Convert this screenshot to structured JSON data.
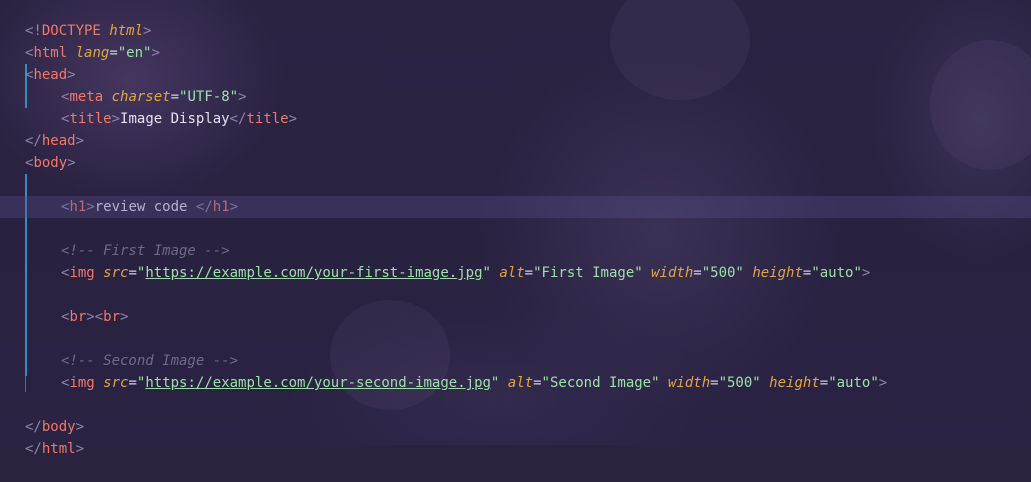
{
  "editor": {
    "language": "html",
    "colors": {
      "background": "#2a2340",
      "tag": "#f2786b",
      "attribute": "#e2a53e",
      "string": "#9de0a8",
      "text": "#e6e2f0",
      "comment": "#6f6a88",
      "punctuation": "#8d86a8",
      "guide": "#2f8fc2"
    },
    "lines": [
      {
        "doctype_open": "<!",
        "doctype_kw": "DOCTYPE",
        "doctype_val": " html",
        "doctype_close": ">"
      },
      {
        "tag": "html",
        "attr": "lang",
        "value": "\"en\""
      },
      {
        "tag": "head"
      },
      {
        "tag": "meta",
        "attr": "charset",
        "value": "\"UTF-8\""
      },
      {
        "tag": "title",
        "text": "Image Display",
        "close_tag": "title"
      },
      {
        "close_tag": "head"
      },
      {
        "tag": "body"
      },
      {
        "text": ""
      },
      {
        "tag": "h1",
        "text": "review code ",
        "close_tag": "h1"
      },
      {
        "text": ""
      },
      {
        "comment": "<!-- First Image -->"
      },
      {
        "tag": "img",
        "src_attr": "src",
        "src": "https://example.com/your-first-image.jpg",
        "alt_attr": "alt",
        "alt": "\"First Image\"",
        "width_attr": "width",
        "width": "\"500\"",
        "height_attr": "height",
        "height": "\"auto\""
      },
      {
        "text": ""
      },
      {
        "tag_a": "br",
        "tag_b": "br"
      },
      {
        "text": ""
      },
      {
        "comment": "<!-- Second Image -->"
      },
      {
        "tag": "img",
        "src_attr": "src",
        "src": "https://example.com/your-second-image.jpg",
        "alt_attr": "alt",
        "alt": "\"Second Image\"",
        "width_attr": "width",
        "width": "\"500\"",
        "height_attr": "height",
        "height": "\"auto\""
      },
      {
        "text": ""
      },
      {
        "close_tag": "body"
      },
      {
        "close_tag": "html"
      }
    ]
  }
}
